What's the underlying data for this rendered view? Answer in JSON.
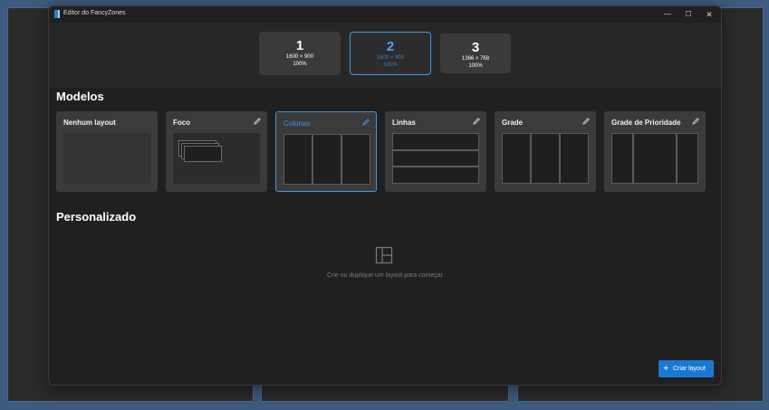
{
  "window": {
    "title": "Editor do FancyZones"
  },
  "controls": {
    "minimize": "—",
    "maximize": "☐",
    "close": "✕"
  },
  "monitors": [
    {
      "number": "1",
      "resolution": "1600 × 900",
      "scale": "100%",
      "selected": false
    },
    {
      "number": "2",
      "resolution": "1600 × 900",
      "scale": "100%",
      "selected": true
    },
    {
      "number": "3",
      "resolution": "1366 × 768",
      "scale": "100%",
      "selected": false
    }
  ],
  "templates": {
    "heading": "Modelos",
    "items": [
      {
        "name": "Nenhum layout",
        "editable": false,
        "selected": false
      },
      {
        "name": "Foco",
        "editable": true,
        "selected": false
      },
      {
        "name": "Colunas",
        "editable": true,
        "selected": true
      },
      {
        "name": "Linhas",
        "editable": true,
        "selected": false
      },
      {
        "name": "Grade",
        "editable": true,
        "selected": false
      },
      {
        "name": "Grade de Prioridade",
        "editable": true,
        "selected": false
      }
    ]
  },
  "custom": {
    "heading": "Personalizado",
    "empty_message": "Crie ou duplique um layout para começar",
    "empty_icon": "layout-icon"
  },
  "create_button": {
    "label": "Criar layout",
    "icon": "+"
  },
  "colors": {
    "accent": "#1a78d4",
    "background": "#202020",
    "card": "#3b3b3b",
    "desktop": "#3d5a80"
  }
}
